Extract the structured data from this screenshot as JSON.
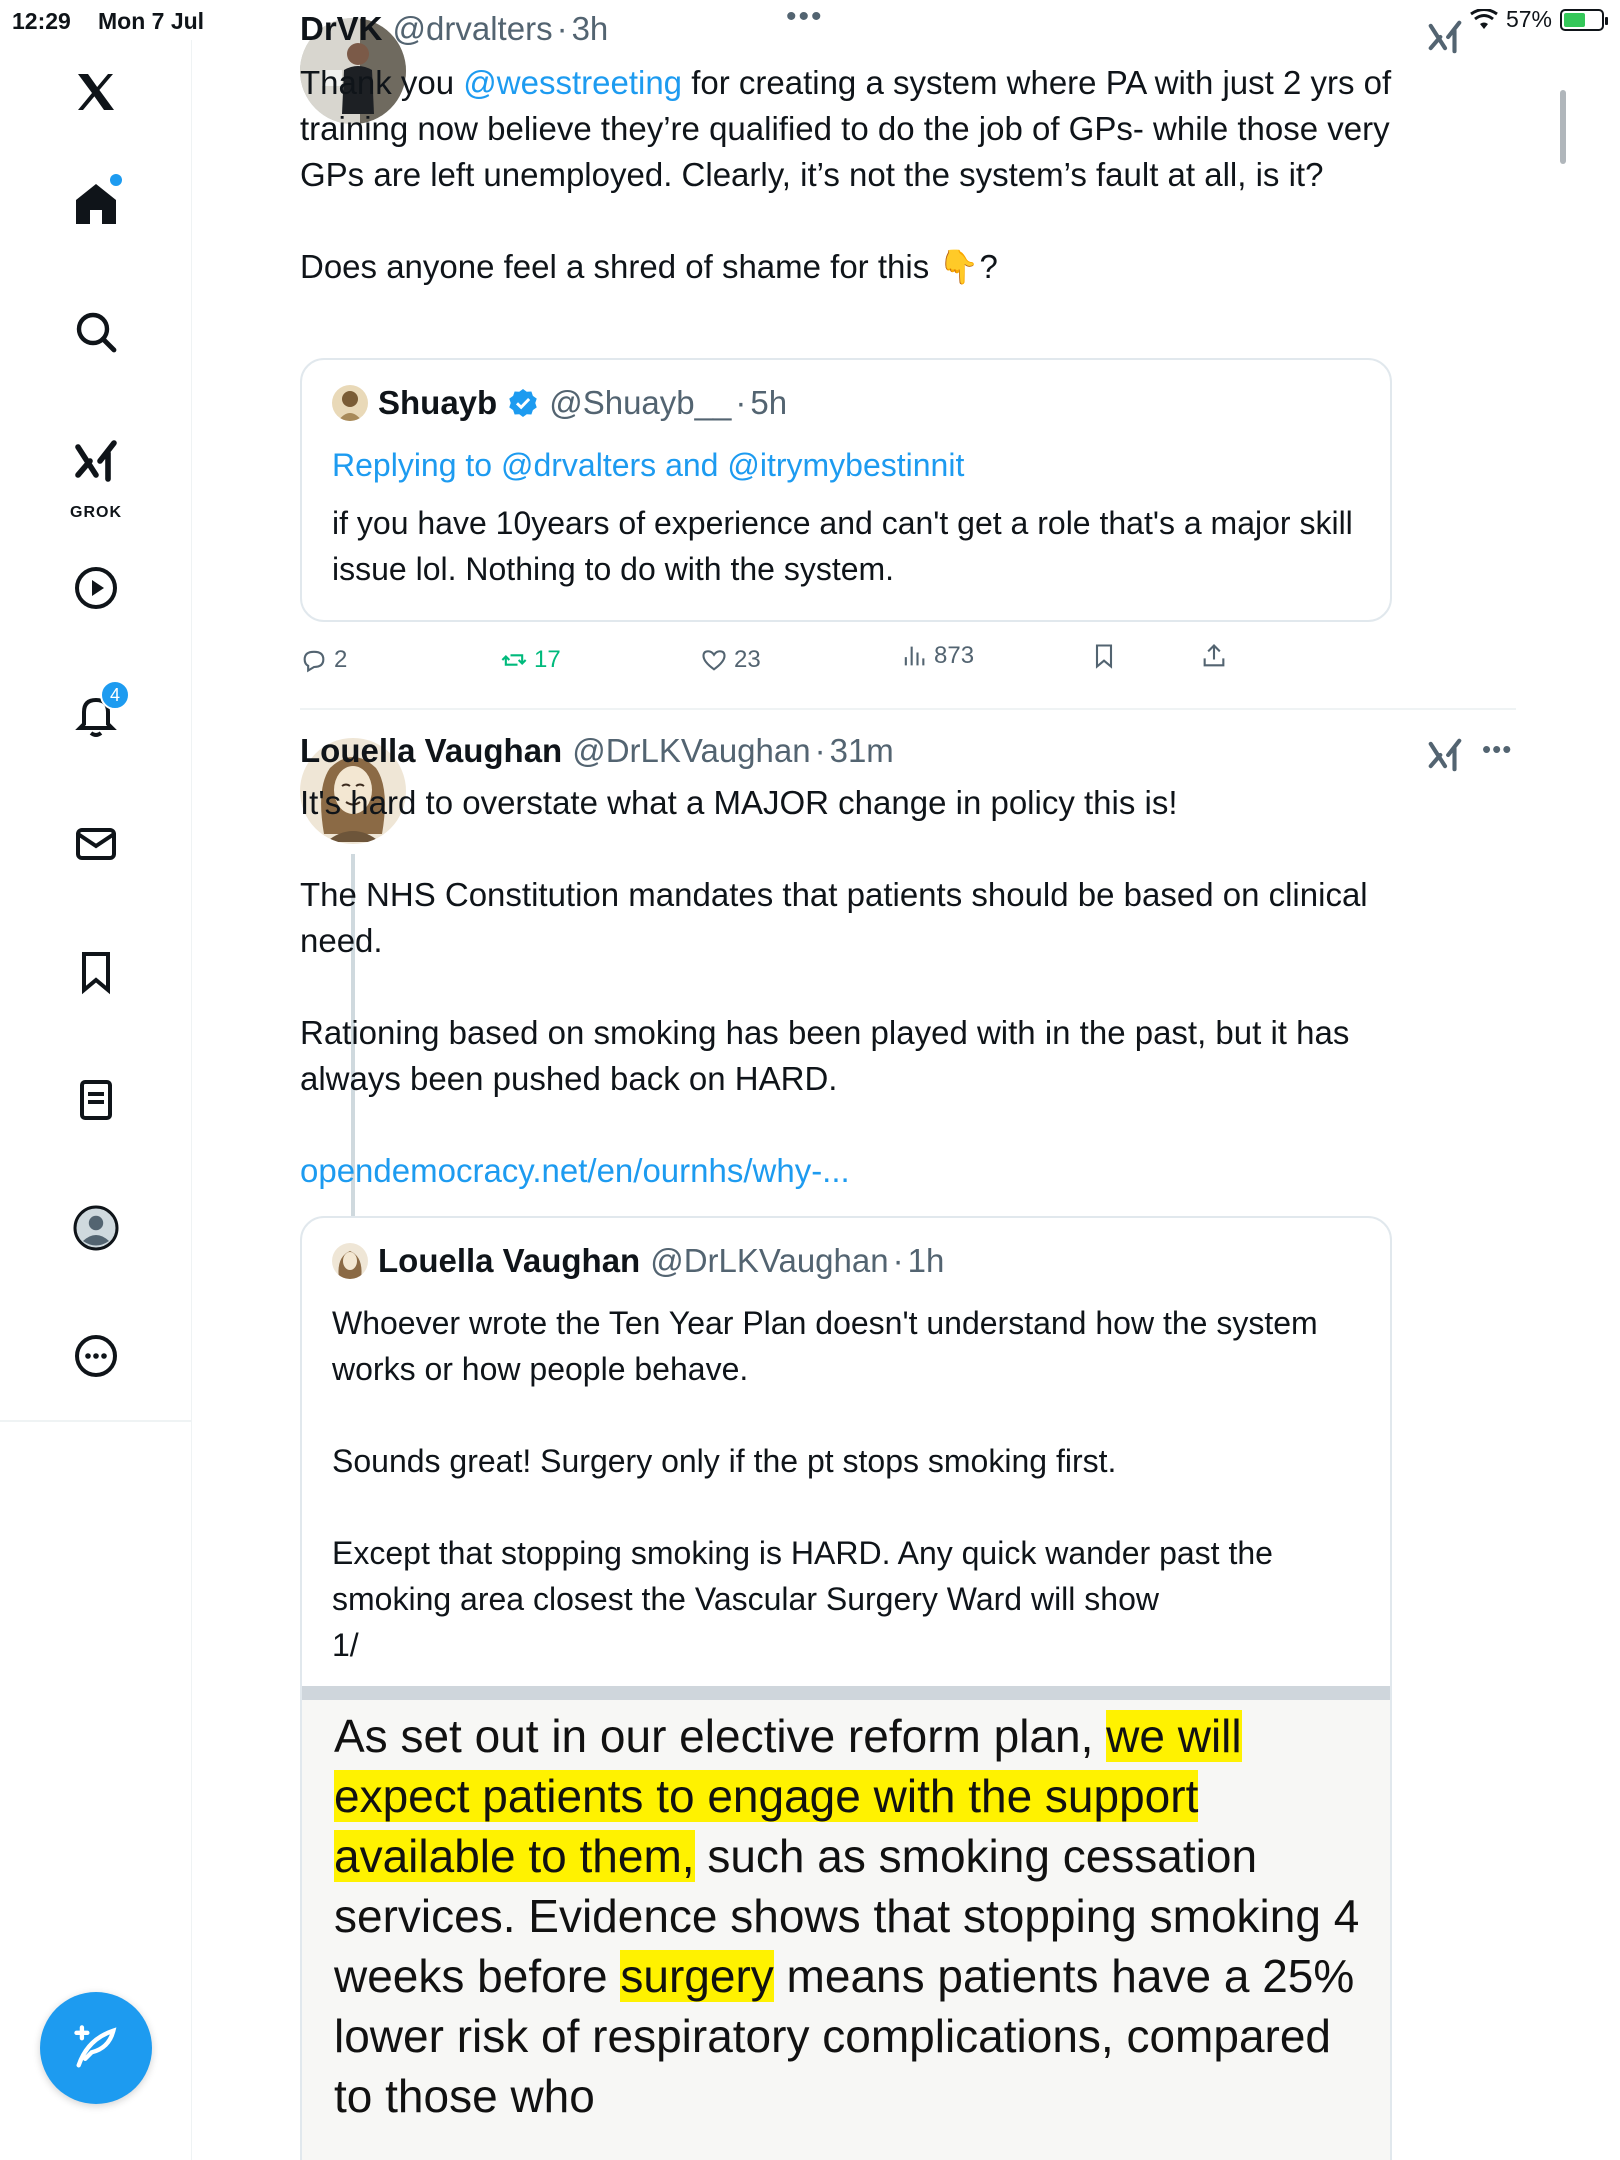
{
  "status_bar": {
    "time": "12:29",
    "date": "Mon 7 Jul",
    "battery": "57%",
    "battery_level": 0.57
  },
  "sidebar": {
    "items": [
      {
        "icon": "x-logo-icon"
      },
      {
        "icon": "home-icon"
      },
      {
        "icon": "search-icon"
      },
      {
        "icon": "grok-icon",
        "label": "GROK"
      },
      {
        "icon": "play-icon"
      },
      {
        "icon": "bell-icon",
        "badge": "4"
      },
      {
        "icon": "mail-icon"
      },
      {
        "icon": "bookmark-icon"
      },
      {
        "icon": "lists-icon"
      },
      {
        "icon": "profile-icon"
      },
      {
        "icon": "more-icon"
      }
    ],
    "compose_icon": "compose-icon"
  },
  "tweets": [
    {
      "name": "DrVK",
      "handle": "@drvalters",
      "sep": "·",
      "time": "3h",
      "body": {
        "line1_pre": "Thank you ",
        "mention": "@wesstreeting",
        "line1_post": " for creating a system where PA with just 2 yrs of training now believe they’re qualified to do the job of GPs- while those very GPs are left unemployed. Clearly, it’s not the system’s fault at all, is it?",
        "line2_pre": "Does anyone feel a shred of shame for this ",
        "emoji": "👇",
        "line2_post": "?"
      },
      "quote": {
        "name": "Shuayb",
        "handle": "@Shuayb__",
        "sep": "·",
        "time": "5h",
        "replying_prefix": "Replying to ",
        "replying_mentions": "@drvalters and @itrymybestinnit",
        "text": "if you have 10years of experience and can't get a role that's a major skill issue lol. Nothing to do with the system."
      },
      "actions": {
        "replies": "2",
        "reposts": "17",
        "likes": "23",
        "views": "873"
      }
    },
    {
      "name": "Louella Vaughan",
      "handle": "@DrLKVaughan",
      "sep": "·",
      "time": "31m",
      "body": {
        "p1": "It's hard to overstate what a MAJOR change in policy this is!",
        "p2": "The NHS Constitution mandates that patients should be based on clinical need.",
        "p3": "Rationing based on smoking has been played with in the past, but it has always been pushed back on HARD.",
        "link": "opendemocracy.net/en/ournhs/why-..."
      },
      "quote": {
        "name": "Louella Vaughan",
        "handle": "@DrLKVaughan",
        "sep": "·",
        "time": "1h",
        "p1": "Whoever wrote the Ten Year Plan doesn't understand how the system works or how people behave.",
        "p2": "Sounds great! Surgery only if the pt stops smoking first.",
        "p3": "Except that stopping smoking is HARD. Any quick wander past the smoking area closest the Vascular Surgery Ward will show",
        "p3b": "1/",
        "image_text": {
          "t1": "As set out in our elective reform plan, ",
          "h1": "we will expect patients to engage with the support available to them,",
          "t2": " such as smoking cessation services. Evidence shows that stopping smoking 4 weeks before ",
          "h2": "surgery",
          "t3": " means patients have a 25% lower risk of respiratory complications, compared to those who"
        }
      }
    }
  ],
  "colors": {
    "accent": "#1d9bf0",
    "repost": "#00ba7c",
    "highlight": "#fff200",
    "text": "#0f1419",
    "muted": "#536471"
  }
}
